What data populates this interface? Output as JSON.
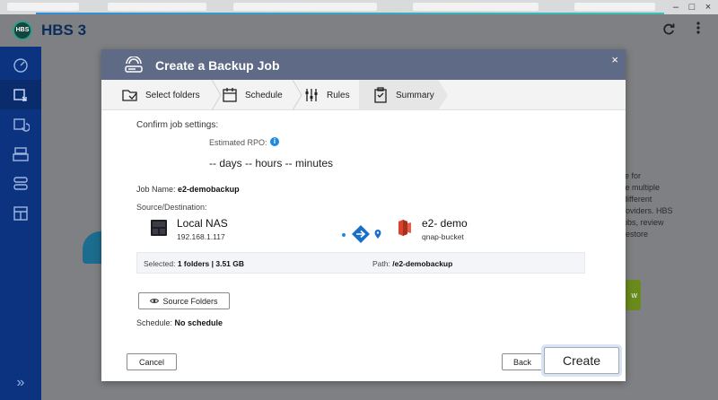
{
  "app": {
    "title": "HBS 3",
    "logo_text": "HBS"
  },
  "window_controls": {
    "minimize": "–",
    "maximize": "□",
    "close": "×"
  },
  "header": {
    "refresh_icon": "refresh-icon",
    "menu_icon": "kebab-menu-icon"
  },
  "sidebar": {
    "items": [
      {
        "icon": "dashboard-icon"
      },
      {
        "icon": "backup-icon",
        "active": true
      },
      {
        "icon": "sync-icon"
      },
      {
        "icon": "restore-icon"
      },
      {
        "icon": "storage-icon"
      },
      {
        "icon": "services-icon"
      }
    ],
    "collapse_label": "»"
  },
  "background": {
    "text_lines": [
      "le for",
      "te multiple",
      "different",
      "roviders. HBS",
      "obs, review",
      "restore"
    ],
    "green_button_label": "w"
  },
  "dialog": {
    "title": "Create a Backup Job",
    "close": "×",
    "steps": [
      {
        "label": "Select folders",
        "icon": "folder-check-icon"
      },
      {
        "label": "Schedule",
        "icon": "calendar-icon"
      },
      {
        "label": "Rules",
        "icon": "sliders-icon"
      },
      {
        "label": "Summary",
        "icon": "clipboard-icon",
        "current": true
      }
    ],
    "confirm_heading": "Confirm job settings:",
    "rpo_label": "Estimated RPO:",
    "rpo_value": "-- days -- hours -- minutes",
    "job_name_label": "Job Name:",
    "job_name_value": "e2-demobackup",
    "source_destination_label": "Source/Destination:",
    "source": {
      "name": "Local NAS",
      "ip": "192.168.1.117"
    },
    "destination": {
      "name": "e2- demo",
      "bucket": "qnap-bucket"
    },
    "selected_label": "Selected:",
    "selected_value": "1 folders | 3.51 GB",
    "path_label": "Path:",
    "path_value": "/e2-demobackup",
    "source_folders_button": "Source Folders",
    "schedule_label": "Schedule:",
    "schedule_value": "No schedule",
    "cancel_button": "Cancel",
    "back_button": "Back",
    "create_button": "Create"
  },
  "colors": {
    "sidebar": "#0b3380",
    "dialog_header": "#5f6a86",
    "accent_blue": "#1a8be0",
    "brand_title": "#0a2e5a"
  }
}
